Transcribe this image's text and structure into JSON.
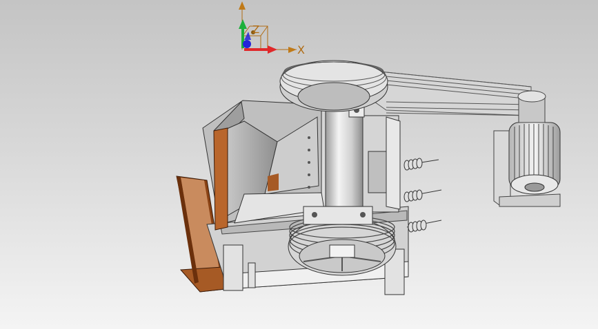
{
  "triad": {
    "x_label": "X",
    "z_label": "Z"
  },
  "colors": {
    "background_top": "#c4c4c4",
    "background_bottom": "#f4f4f4",
    "metal_light": "#e6e6e6",
    "metal_mid": "#bdbdbd",
    "metal_dark": "#8a8a8a",
    "copper": "#b8652a",
    "copper_dark": "#7c3a12",
    "axis_x": "#e0282a",
    "axis_y": "#1bb03a",
    "axis_z": "#2424d8",
    "axis_annot": "#b06c14"
  },
  "model": {
    "name_icon": "jaw-crusher-assembly-icon",
    "parts": [
      "flywheel-top",
      "flywheel-bottom",
      "motor",
      "v-belts",
      "hopper",
      "discharge-chute",
      "frame",
      "tension-springs"
    ]
  }
}
